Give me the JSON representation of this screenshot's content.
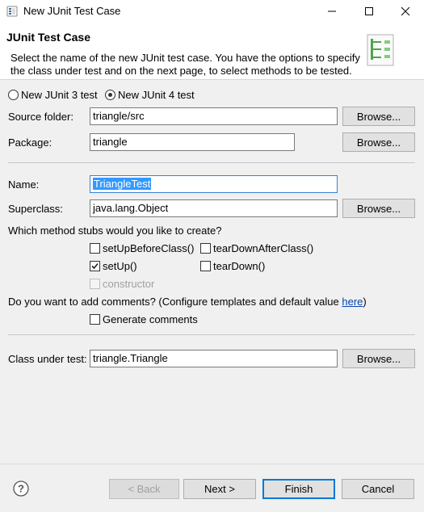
{
  "window": {
    "title": "New JUnit Test Case"
  },
  "header": {
    "title": "JUnit Test Case",
    "description": "Select the name of the new JUnit test case. You have the options to specify the class under test and on the next page, to select methods to be tested."
  },
  "junit_version": {
    "option3": "New JUnit 3 test",
    "option4": "New JUnit 4 test",
    "selected": "New JUnit 4 test"
  },
  "source_folder": {
    "label": "Source folder:",
    "value": "triangle/src",
    "browse": "Browse..."
  },
  "package": {
    "label": "Package:",
    "value": "triangle",
    "browse": "Browse..."
  },
  "name": {
    "label": "Name:",
    "value": "TriangleTest"
  },
  "superclass": {
    "label": "Superclass:",
    "value": "java.lang.Object",
    "browse": "Browse..."
  },
  "stubs": {
    "question": "Which method stubs would you like to create?",
    "setUpBeforeClass": {
      "label": "setUpBeforeClass()",
      "checked": false
    },
    "tearDownAfterClass": {
      "label": "tearDownAfterClass()",
      "checked": false
    },
    "setUp": {
      "label": "setUp()",
      "checked": true
    },
    "tearDown": {
      "label": "tearDown()",
      "checked": false
    },
    "constructor": {
      "label": "constructor",
      "checked": false,
      "enabled": false
    }
  },
  "comments": {
    "question": "Do you want to add comments? (Configure templates and default value ",
    "link": "here",
    "question_end": ")",
    "generate_label": "Generate comments",
    "checked": false
  },
  "class_under_test": {
    "label": "Class under test:",
    "value": "triangle.Triangle",
    "browse": "Browse..."
  },
  "footer": {
    "back": "< Back",
    "next": "Next >",
    "finish": "Finish",
    "cancel": "Cancel"
  }
}
